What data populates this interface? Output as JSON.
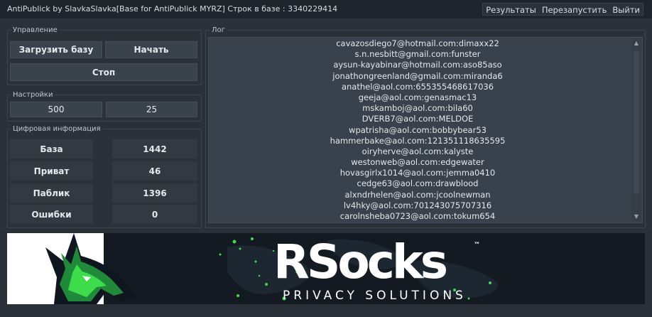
{
  "titlebar": {
    "title": "AntiPublick by SlavkaSlavka[Base for AntiPublick MYRZ] Строк в базе : 3340229414",
    "menu": [
      {
        "label": "Результаты"
      },
      {
        "label": "Перезапустить"
      },
      {
        "label": "Выйти"
      }
    ]
  },
  "control": {
    "label": "Управление",
    "load_button": "Загрузить базу",
    "start_button": "Начать",
    "stop_button": "Стоп"
  },
  "settings": {
    "label": "Настройки",
    "value_1": "500",
    "value_2": "25"
  },
  "stats": {
    "label": "Цифровая информация",
    "rows": [
      {
        "label": "База",
        "value": "1442"
      },
      {
        "label": "Приват",
        "value": "46"
      },
      {
        "label": "Паблик",
        "value": "1396"
      },
      {
        "label": "Ошибки",
        "value": "0"
      }
    ]
  },
  "log": {
    "label": "Лог",
    "lines": [
      "cavazosdiego7@hotmail.com:dimaxx22",
      "s.n.nesbitt@gmail.com:funster",
      "aysun-kayabinar@hotmail.com:aso85aso",
      "jonathongreenland@gmail.com:miranda6",
      "anathel@aol.com:655355468617036",
      "geeja@aol.com:genasmac13",
      "mskamboj@aol.com:bila60",
      "DVERB7@aol.com:MELDOE",
      "wpatrisha@aol.com:bobbybear53",
      "hammerbake@aol.com:121351118635595",
      "oiryherve@aol.com:kalyste",
      "westonweb@aol.com:edgewater",
      "hovasgirlx1014@aol.com:jemma0410",
      "cedge63@aol.com:drawblood",
      "alxndrhelen@aol.com:jcoolnewman",
      "lv4hky@aol.com:701243075707316",
      "carolnsheba0723@aol.com:tokum654"
    ]
  },
  "banner": {
    "brand": "RSocks",
    "trademark": "™",
    "tagline": "PRIVACY SOLUTIONS",
    "icons": [
      "wolf-logo-icon",
      "world-map-icon",
      "scroll-up-icon",
      "scroll-down-icon"
    ]
  },
  "colors": {
    "background": "#2b3139",
    "titlebar": "#1f252c",
    "button": "#3a424b",
    "log_background": "#39424c",
    "banner_background": "#131a22",
    "accent_green": "#3ddc4a"
  }
}
